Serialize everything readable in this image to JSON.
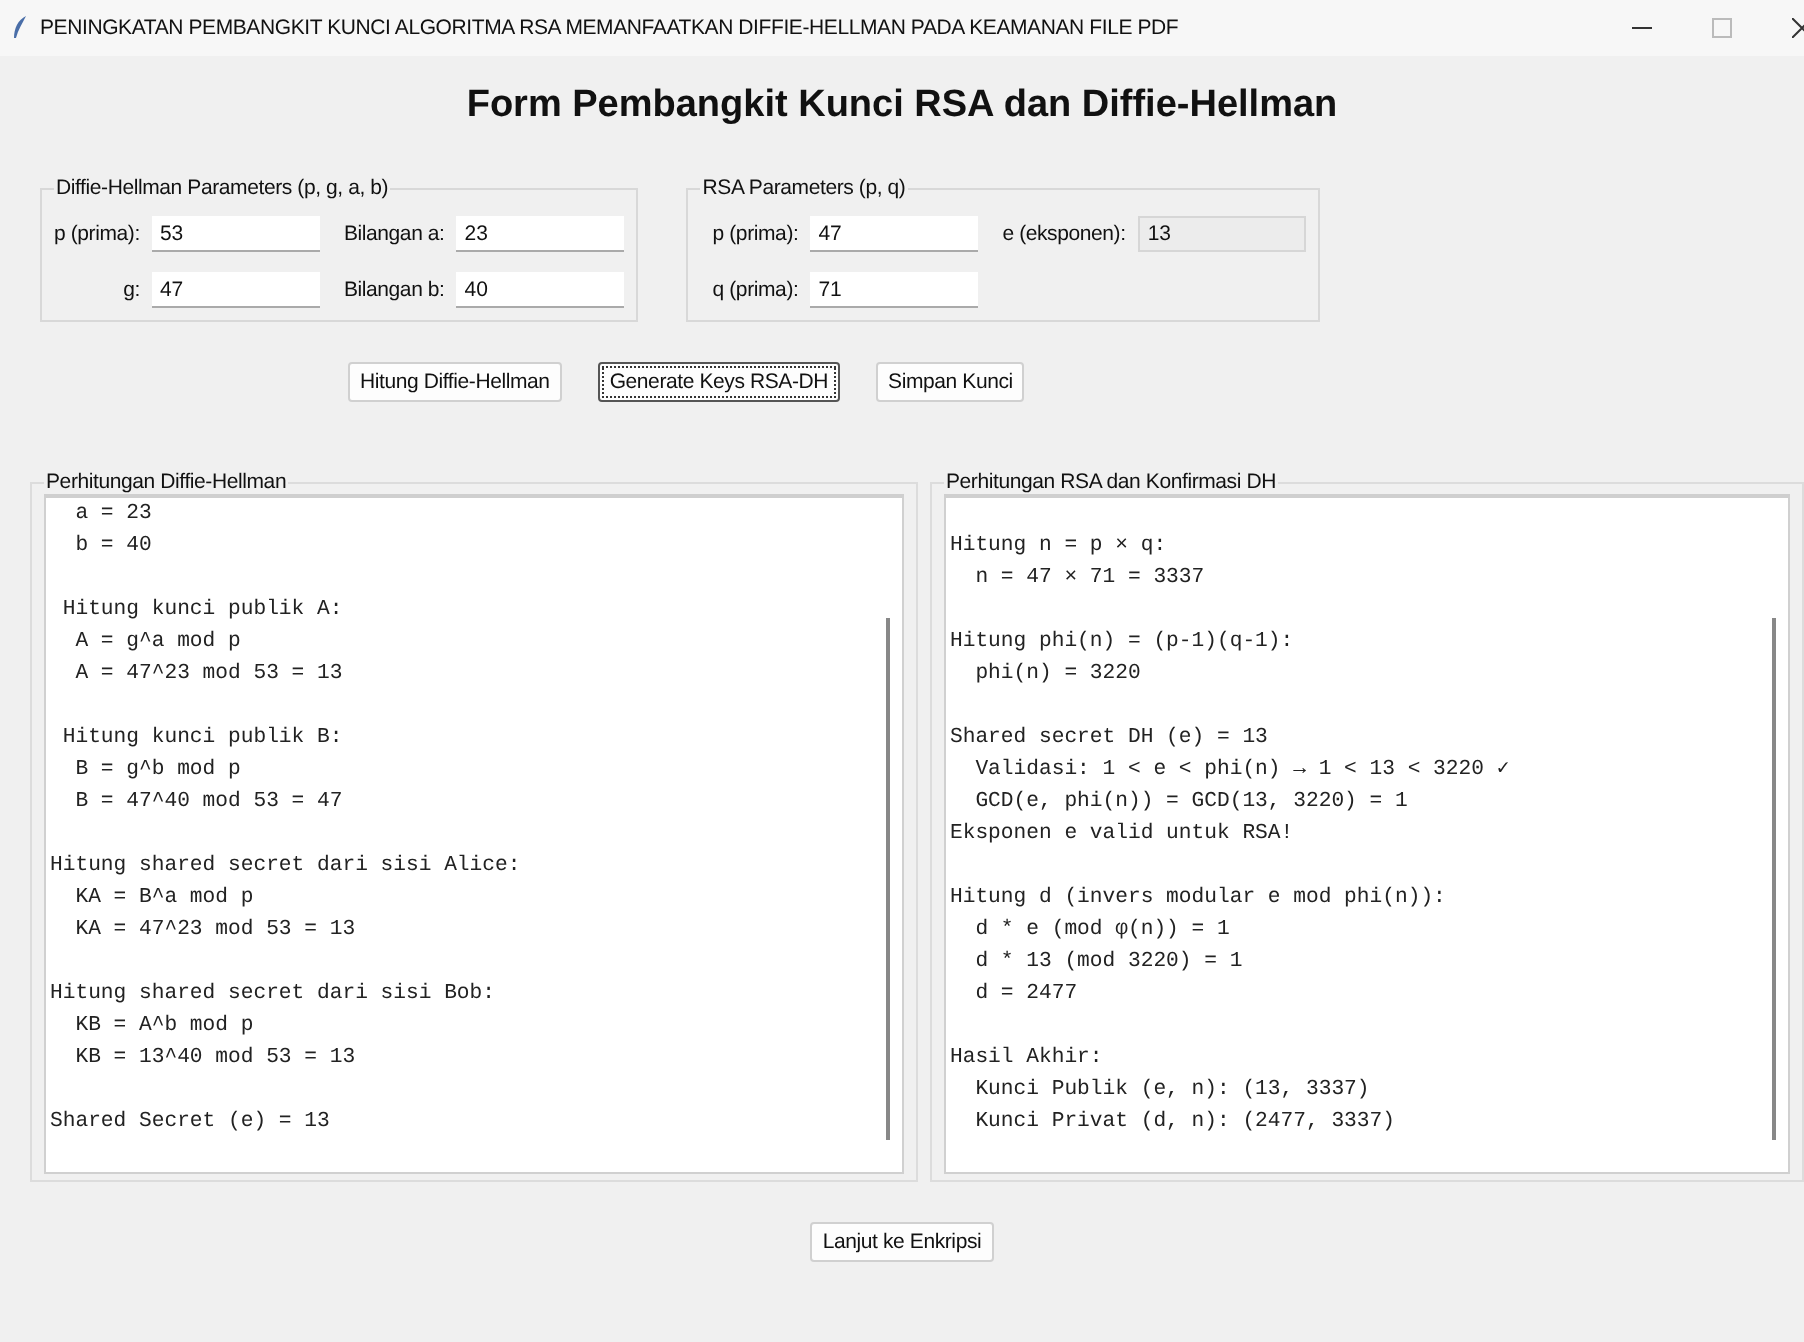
{
  "window": {
    "title": "PENINGKATAN PEMBANGKIT KUNCI ALGORITMA RSA MEMANFAATKAN DIFFIE-HELLMAN PADA KEAMANAN FILE PDF"
  },
  "heading": "Form Pembangkit Kunci RSA dan Diffie-Hellman",
  "parameter_groups": [
    {
      "title": "Diffie-Hellman Parameters (p, g, a, b)",
      "fields": [
        {
          "label": "p (prima):",
          "value": "53",
          "readonly": false
        },
        {
          "label": "Bilangan a:",
          "value": "23",
          "readonly": false
        },
        {
          "label": "g:",
          "value": "47",
          "readonly": false
        },
        {
          "label": "Bilangan b:",
          "value": "40",
          "readonly": false
        }
      ]
    },
    {
      "title": "RSA Parameters (p, q)",
      "fields": [
        {
          "label": "p (prima):",
          "value": "47",
          "readonly": false
        },
        {
          "label": "e (eksponen):",
          "value": "13",
          "readonly": true
        },
        {
          "label": "q (prima):",
          "value": "71",
          "readonly": false
        }
      ]
    }
  ],
  "buttons": [
    {
      "label": "Hitung Diffie-Hellman",
      "focused": false
    },
    {
      "label": "Generate Keys RSA-DH",
      "focused": true
    },
    {
      "label": "Simpan Kunci",
      "focused": false
    }
  ],
  "panels": [
    {
      "title": "Perhitungan Diffie-Hellman",
      "starts_blank": false,
      "blocks": [
        [
          "  a = 23",
          "  b = 40"
        ],
        [
          " Hitung kunci publik A:",
          "  A = g^a mod p",
          "  A = 47^23 mod 53 = 13"
        ],
        [
          " Hitung kunci publik B:",
          "  B = g^b mod p",
          "  B = 47^40 mod 53 = 47"
        ],
        [
          "Hitung shared secret dari sisi Alice:",
          "  KA = B^a mod p",
          "  KA = 47^23 mod 53 = 13"
        ],
        [
          "Hitung shared secret dari sisi Bob:",
          "  KB = A^b mod p",
          "  KB = 13^40 mod 53 = 13"
        ],
        [
          "Shared Secret (e) = 13"
        ]
      ]
    },
    {
      "title": "Perhitungan RSA dan Konfirmasi DH",
      "starts_blank": true,
      "blocks": [
        [
          "Hitung n = p × q:",
          "  n = 47 × 71 = 3337"
        ],
        [
          "Hitung phi(n) = (p-1)(q-1):",
          "  phi(n) = 3220"
        ],
        [
          "Shared secret DH (e) = 13",
          "  Validasi: 1 < e < phi(n) → 1 < 13 < 3220 ✓",
          "  GCD(e, phi(n)) = GCD(13, 3220) = 1",
          "Eksponen e valid untuk RSA!"
        ],
        [
          "Hitung d (invers modular e mod phi(n)):",
          "  d * e (mod φ(n)) = 1",
          "  d * 13 (mod 3220) = 1",
          "  d = 2477"
        ],
        [
          "Hasil Akhir:",
          "  Kunci Publik (e, n): (13, 3337)",
          "  Kunci Privat (d, n): (2477, 3337)"
        ]
      ]
    }
  ],
  "footer_button": {
    "label": "Lanjut ke Enkripsi"
  }
}
